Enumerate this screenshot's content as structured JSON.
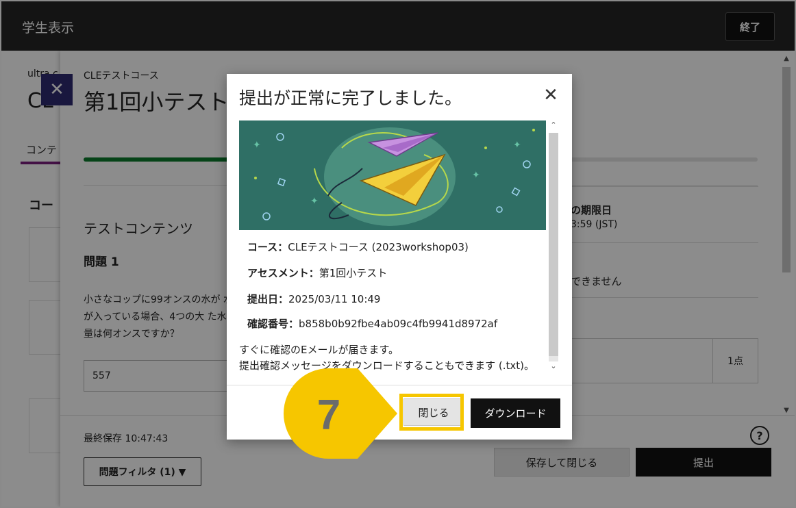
{
  "topbar": {
    "title": "学生表示",
    "end_label": "終了"
  },
  "background": {
    "breadcrumb": "ultra c",
    "big_title": "CL",
    "tab": "コンテ",
    "section": "コー"
  },
  "panel": {
    "close_symbol": "✕",
    "course": "CLEテストコース",
    "title": "第1回小テスト",
    "progress": 0.22,
    "content_heading": "テストコンテンツ",
    "question_label": "問題 1",
    "question_text": "小さなコップに99オンスの水が 水が入っている場合、4つの大 た水の量は何オンスですか？",
    "answer_value": "557",
    "due_label": "の期限日",
    "due_value": "3:59 (JST)",
    "cannot_text": "できません",
    "points": "1点",
    "last_save": "最終保存 10:47:43",
    "filter_label": "問題フィルタ (1) ▼",
    "help_symbol": "?",
    "save_close_label": "保存して閉じる",
    "submit_label": "提出"
  },
  "modal": {
    "title": "提出が正常に完了しました。",
    "close_symbol": "✕",
    "rows": [
      {
        "label": "コース：",
        "value": "CLEテストコース (2023workshop03)"
      },
      {
        "label": "アセスメント：",
        "value": "第1回小テスト"
      },
      {
        "label": "提出日：",
        "value": "2025/03/11 10:49"
      },
      {
        "label": "確認番号：",
        "value": "b858b0b92fbe4ab09c4fb9941d8972af"
      }
    ],
    "note_line1": "すぐに確認のEメールが届きます。",
    "note_line2": "提出確認メッセージをダウンロードすることもできます (.txt)。",
    "close_button": "閉じる",
    "download_button": "ダウンロード"
  },
  "annotation": {
    "step_number": "7",
    "color": "#f6c600"
  },
  "colors": {
    "topbar": "#262626",
    "progress": "#0b7a2c",
    "panel_close": "#2e2a72",
    "illustration_bg": "#2f6f65"
  }
}
